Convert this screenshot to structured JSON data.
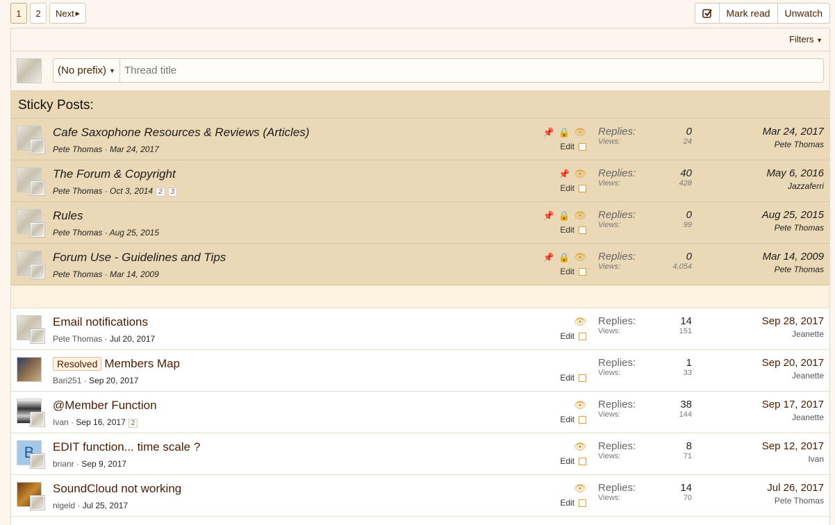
{
  "pager": {
    "pages": [
      "1",
      "2"
    ],
    "next": "Next"
  },
  "actions": {
    "check_icon": "check-square-icon",
    "mark_read": "Mark read",
    "unwatch": "Unwatch"
  },
  "filters": {
    "label": "Filters"
  },
  "new_thread": {
    "prefix": "(No prefix)",
    "placeholder": "Thread title"
  },
  "sticky_header": "Sticky Posts:",
  "sticky_threads": [
    {
      "title": "Cafe Saxophone Resources & Reviews (Articles)",
      "author": "Pete Thomas",
      "date": "Mar 24, 2017",
      "pages": [],
      "replies": "0",
      "views": "24",
      "last_date": "Mar 24, 2017",
      "last_user": "Pete Thomas",
      "edit": "Edit"
    },
    {
      "title": "The Forum & Copyright",
      "author": "Pete Thomas",
      "date": "Oct 3, 2014",
      "pages": [
        "2",
        "3"
      ],
      "replies": "40",
      "views": "428",
      "last_date": "May 6, 2016",
      "last_user": "Jazzaferri",
      "edit": "Edit"
    },
    {
      "title": "Rules",
      "author": "Pete Thomas",
      "date": "Aug 25, 2015",
      "pages": [],
      "replies": "0",
      "views": "99",
      "last_date": "Aug 25, 2015",
      "last_user": "Pete Thomas",
      "edit": "Edit"
    },
    {
      "title": "Forum Use - Guidelines and Tips",
      "author": "Pete Thomas",
      "date": "Mar 14, 2009",
      "pages": [],
      "replies": "0",
      "views": "4,054",
      "last_date": "Mar 14, 2009",
      "last_user": "Pete Thomas",
      "edit": "Edit"
    }
  ],
  "threads": [
    {
      "prefix": "",
      "title": "Email notifications",
      "author": "Pete Thomas",
      "date": "Jul 20, 2017",
      "pages": [],
      "replies": "14",
      "views": "151",
      "last_date": "Sep 28, 2017",
      "last_user": "Jeanette",
      "edit": "Edit"
    },
    {
      "prefix": "Resolved",
      "title": "Members Map",
      "author": "Bari251",
      "date": "Sep 20, 2017",
      "pages": [],
      "replies": "1",
      "views": "33",
      "last_date": "Sep 20, 2017",
      "last_user": "Jeanette",
      "edit": "Edit"
    },
    {
      "prefix": "",
      "title": "@Member Function",
      "author": "Ivan",
      "date": "Sep 16, 2017",
      "pages": [
        "2"
      ],
      "replies": "38",
      "views": "144",
      "last_date": "Sep 17, 2017",
      "last_user": "Jeanette",
      "edit": "Edit"
    },
    {
      "prefix": "",
      "title": "EDIT function... time scale ?",
      "author": "brianr",
      "date": "Sep 9, 2017",
      "pages": [],
      "replies": "8",
      "views": "71",
      "last_date": "Sep 12, 2017",
      "last_user": "Ivan",
      "edit": "Edit",
      "avatar_letter": "B"
    },
    {
      "prefix": "",
      "title": "SoundCloud not working",
      "author": "nigeld",
      "date": "Jul 25, 2017",
      "pages": [],
      "replies": "14",
      "views": "70",
      "last_date": "Jul 26, 2017",
      "last_user": "Pete Thomas",
      "edit": "Edit"
    }
  ],
  "labels": {
    "replies": "Replies:",
    "views": "Views:"
  }
}
